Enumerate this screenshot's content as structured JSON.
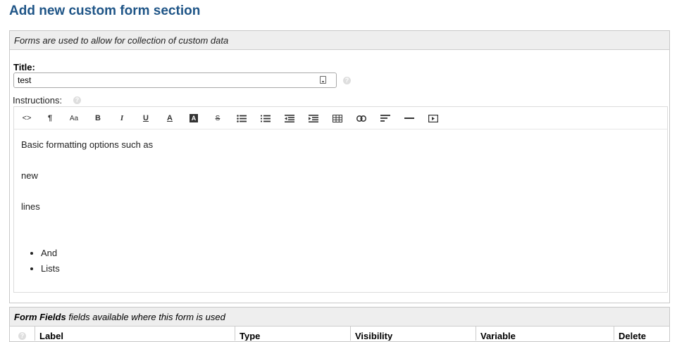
{
  "page": {
    "title": "Add new custom form section"
  },
  "section": {
    "description": "Forms are used to allow for collection of custom data",
    "title_label": "Title:",
    "title_value": "test",
    "instructions_label": "Instructions:",
    "help_glyph": "?"
  },
  "editor": {
    "toolbar": [
      {
        "name": "code-view",
        "glyph": "<>"
      },
      {
        "name": "paragraph",
        "glyph": "¶"
      },
      {
        "name": "font-size",
        "glyph": "Aa"
      },
      {
        "name": "bold",
        "glyph": "B"
      },
      {
        "name": "italic",
        "glyph": "I"
      },
      {
        "name": "underline",
        "glyph": "U"
      },
      {
        "name": "font-color",
        "glyph": "A"
      },
      {
        "name": "background-color",
        "glyph": "A"
      },
      {
        "name": "strikethrough",
        "glyph": "S"
      },
      {
        "name": "unordered-list",
        "glyph": ""
      },
      {
        "name": "ordered-list",
        "glyph": ""
      },
      {
        "name": "outdent",
        "glyph": ""
      },
      {
        "name": "indent",
        "glyph": ""
      },
      {
        "name": "table",
        "glyph": ""
      },
      {
        "name": "link",
        "glyph": ""
      },
      {
        "name": "align",
        "glyph": ""
      },
      {
        "name": "horizontal-rule",
        "glyph": ""
      },
      {
        "name": "video",
        "glyph": ""
      }
    ],
    "lines": [
      "Basic formatting options such as",
      "new",
      "lines"
    ],
    "list_items": [
      "And",
      "Lists"
    ]
  },
  "form_fields": {
    "title": "Form Fields",
    "subtitle": "fields available where this form is used",
    "columns": [
      "Label",
      "Type",
      "Visibility",
      "Variable",
      "Delete"
    ]
  }
}
